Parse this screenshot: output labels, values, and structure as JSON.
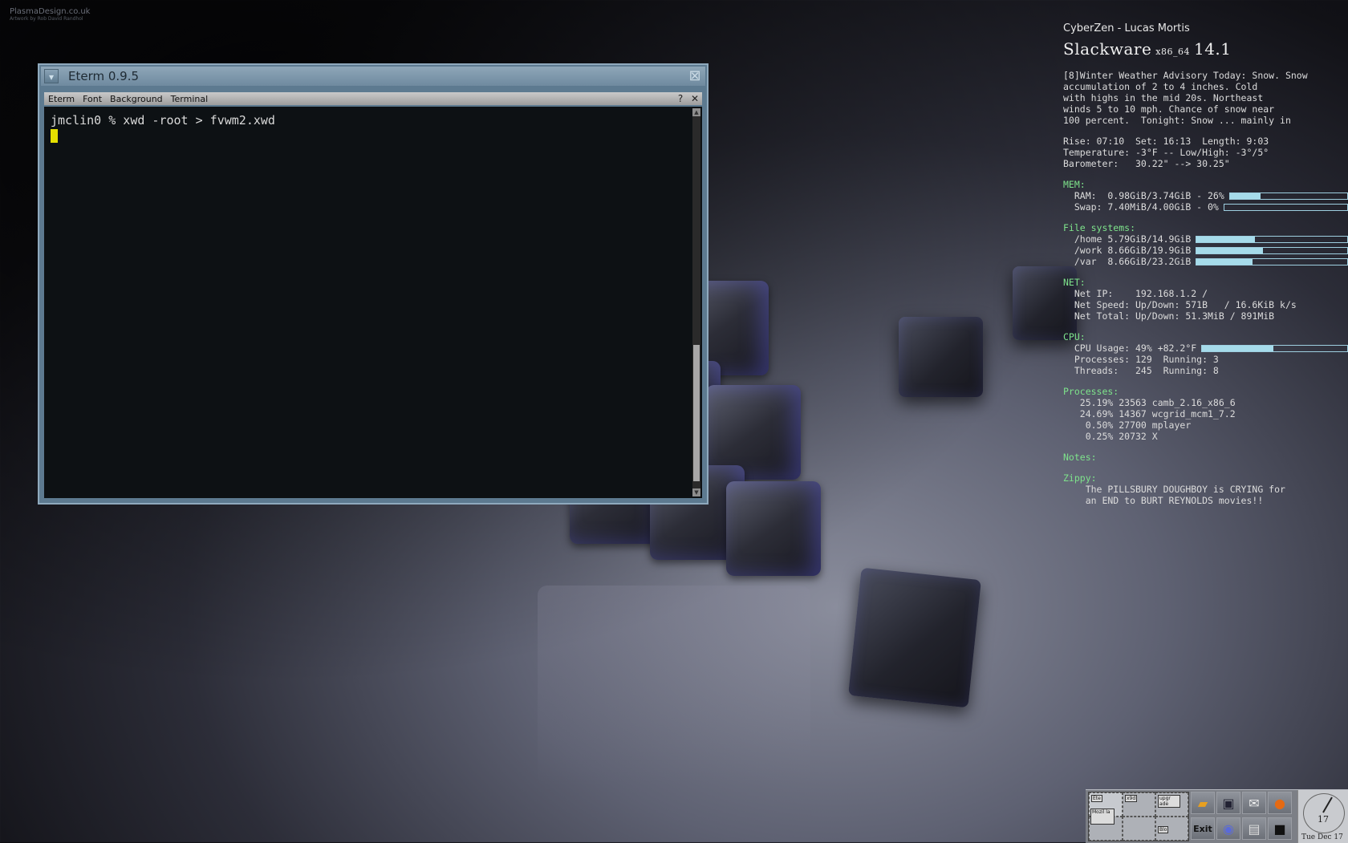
{
  "wallpaper": {
    "credit_line1": "PlasmaDesign.co.uk",
    "credit_line2": "Artwork by Rob David Randhol"
  },
  "eterm": {
    "title": "Eterm 0.9.5",
    "menu": [
      "Eterm",
      "Font",
      "Background",
      "Terminal"
    ],
    "help_btn": "?",
    "close_btn": "✕",
    "prompt_line": "jmclin0 % xwd -root > fvwm2.xwd"
  },
  "conky": {
    "header": "CyberZen - Lucas Mortis",
    "logo": {
      "name": "Slackware",
      "arch": "x86_64",
      "version": "14.1"
    },
    "weather": [
      "[8]Winter Weather Advisory Today: Snow. Snow",
      "accumulation of 2 to 4 inches. Cold",
      "with highs in the mid 20s. Northeast",
      "winds 5 to 10 mph. Chance of snow near",
      "100 percent.  Tonight: Snow ... mainly in"
    ],
    "sun": [
      "Rise: 07:10  Set: 16:13  Length: 9:03",
      "Temperature: -3°F -- Low/High: -3°/5°",
      "Barometer:   30.22\" --> 30.25\""
    ],
    "mem": {
      "label": "MEM:",
      "ram": {
        "text": "  RAM:  0.98GiB/3.74GiB - 26%",
        "pct": 26
      },
      "swap": {
        "text": "  Swap: 7.40MiB/4.00GiB - 0%",
        "pct": 0
      }
    },
    "fs": {
      "label": "File systems:",
      "items": [
        {
          "text": "  /home 5.79GiB/14.9GiB",
          "pct": 39
        },
        {
          "text": "  /work 8.66GiB/19.9GiB",
          "pct": 44
        },
        {
          "text": "  /var  8.66GiB/23.2GiB",
          "pct": 37
        }
      ]
    },
    "net": {
      "label": "NET:",
      "lines": [
        "  Net IP:    192.168.1.2 /",
        "  Net Speed: Up/Down: 571B   / 16.6KiB k/s",
        "  Net Total: Up/Down: 51.3MiB / 891MiB"
      ]
    },
    "cpu": {
      "label": "CPU:",
      "usage": {
        "text": "  CPU Usage: 49% +82.2°F",
        "pct": 49
      },
      "lines": [
        "  Processes: 129  Running: 3",
        "  Threads:   245  Running: 8"
      ]
    },
    "processes": {
      "label": "Processes:",
      "lines": [
        "   25.19% 23563 camb_2.16_x86_6",
        "   24.69% 14367 wcgrid_mcm1_7.2",
        "    0.50% 27700 mplayer",
        "    0.25% 20732 X"
      ]
    },
    "notes_label": "Notes:",
    "zippy": {
      "label": "Zippy:",
      "lines": [
        "    The PILLSBURY DOUGHBOY is CRYING for",
        "    an END to BURT REYNOLDS movies!!"
      ]
    }
  },
  "panel": {
    "pager_windows": [
      "Ete",
      "x9d",
      "upgr ade",
      "Mozil la",
      "Blo"
    ],
    "exit_label": "Exit",
    "clock_day": "17",
    "clock_date": "Tue Dec 17"
  }
}
